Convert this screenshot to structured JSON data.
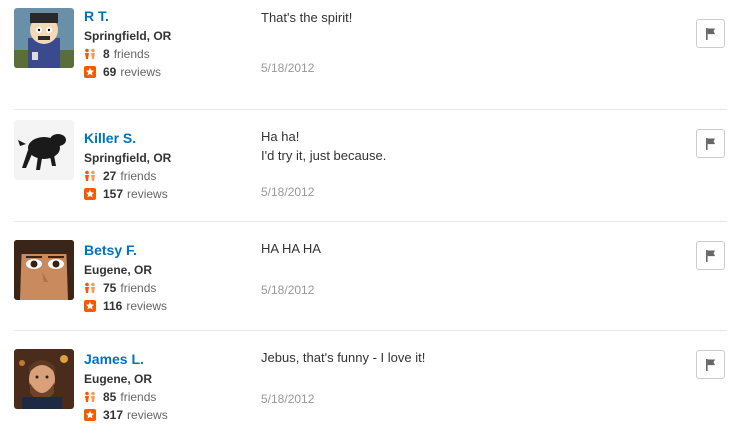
{
  "comments": [
    {
      "name": "R T.",
      "location": "Springfield, OR",
      "friends_count": "8",
      "friends_label": "friends",
      "reviews_count": "69",
      "reviews_label": "reviews",
      "lines": [
        "That's the spirit!"
      ],
      "date": "5/18/2012",
      "avatar": "cartoon-character-avatar"
    },
    {
      "name": "Killer S.",
      "location": "Springfield, OR",
      "friends_count": "27",
      "friends_label": "friends",
      "reviews_count": "157",
      "reviews_label": "reviews",
      "lines": [
        "Ha ha!",
        "I'd try it, just because."
      ],
      "date": "5/18/2012",
      "avatar": "black-dog-avatar"
    },
    {
      "name": "Betsy F.",
      "location": "Eugene, OR",
      "friends_count": "75",
      "friends_label": "friends",
      "reviews_count": "116",
      "reviews_label": "reviews",
      "lines": [
        "HA HA HA"
      ],
      "date": "5/18/2012",
      "avatar": "face-closeup-avatar"
    },
    {
      "name": "James L.",
      "location": "Eugene, OR",
      "friends_count": "85",
      "friends_label": "friends",
      "reviews_count": "317",
      "reviews_label": "reviews",
      "lines": [
        "Jebus, that's funny - I love it!"
      ],
      "date": "5/18/2012",
      "avatar": "bearded-man-avatar"
    }
  ],
  "colors": {
    "user_link": "#0073bb",
    "icon_orange": "#f15c00",
    "date": "#999999",
    "divider": "#e6e6e6"
  }
}
